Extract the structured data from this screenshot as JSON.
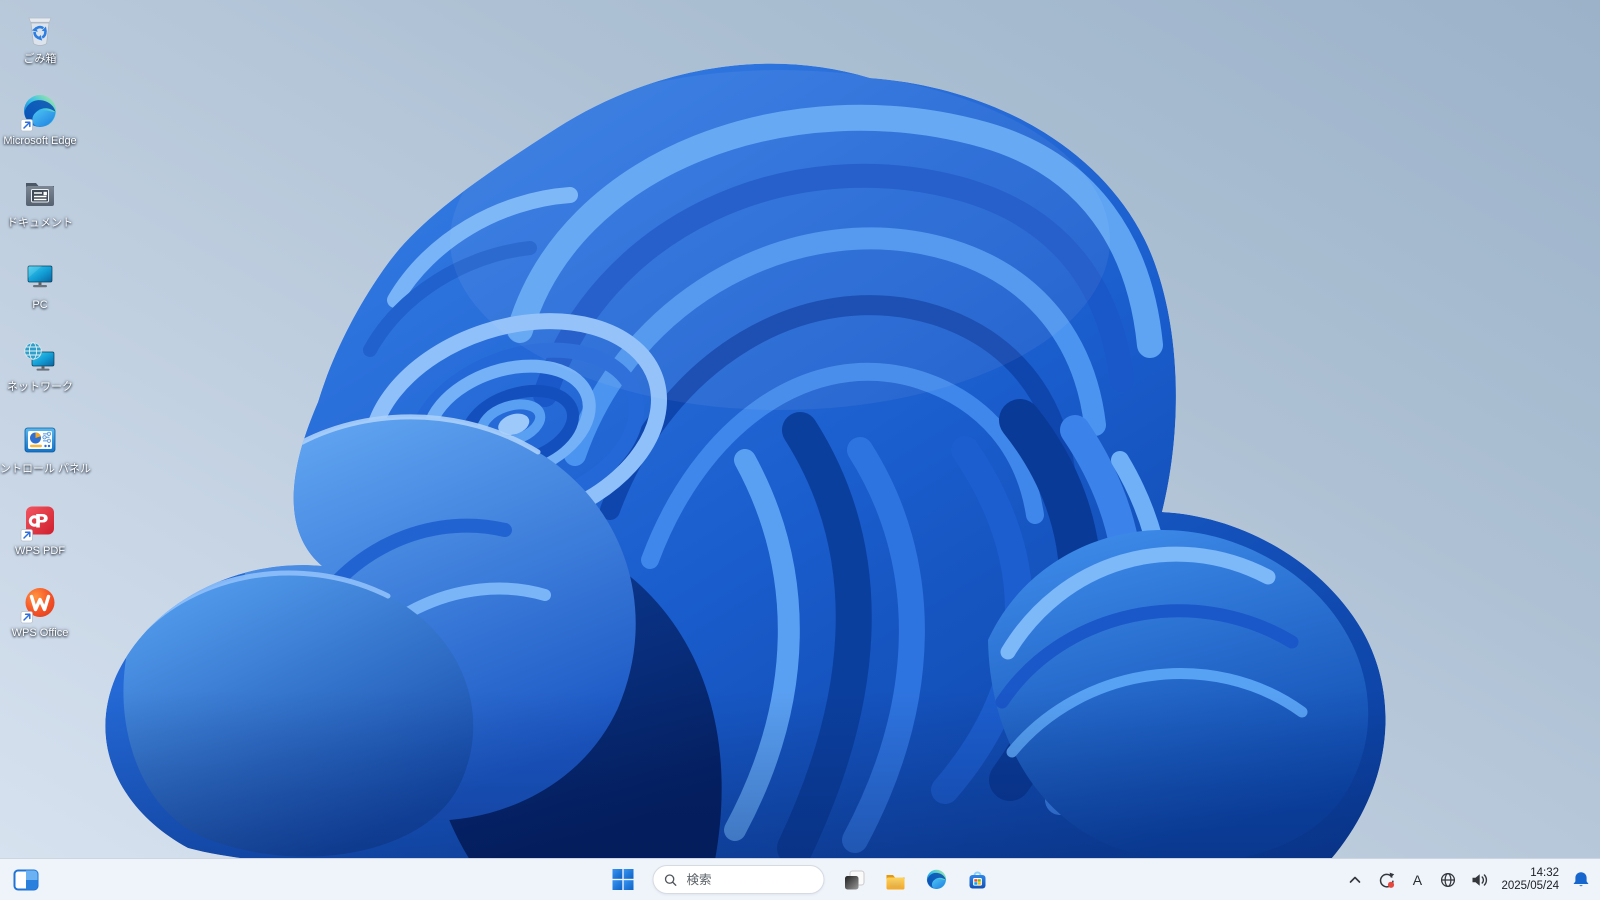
{
  "wallpaper": {
    "name": "windows-11-bloom",
    "background_top_right": "#9bb2c9",
    "background_bottom_left": "#d8e3f0",
    "bloom_primary": "#1f66d9"
  },
  "desktop": {
    "icons": [
      {
        "label": "ごみ箱",
        "icon": "recycle-bin-icon",
        "shortcut": false
      },
      {
        "label": "Microsoft Edge",
        "icon": "edge-icon",
        "shortcut": true
      },
      {
        "label": "ドキュメント",
        "icon": "documents-folder-icon",
        "shortcut": false
      },
      {
        "label": "PC",
        "icon": "pc-monitor-icon",
        "shortcut": false
      },
      {
        "label": "ネットワーク",
        "icon": "network-globe-monitor-icon",
        "shortcut": false
      },
      {
        "label": "コントロール パネル",
        "icon": "control-panel-icon",
        "shortcut": false
      },
      {
        "label": "WPS PDF",
        "icon": "wps-pdf-icon",
        "shortcut": true
      },
      {
        "label": "WPS Office",
        "icon": "wps-office-icon",
        "shortcut": true
      }
    ]
  },
  "taskbar": {
    "colors": {
      "background": "#eff3fa",
      "accent": "#0d6bd0"
    },
    "corner_left": {
      "icon": "widgets-icon"
    },
    "start": {
      "icon": "windows-start-icon"
    },
    "search": {
      "placeholder": "検索",
      "icon": "search-icon"
    },
    "pinned": [
      {
        "icon": "task-view-icon"
      },
      {
        "icon": "file-explorer-icon"
      },
      {
        "icon": "edge-icon"
      },
      {
        "icon": "microsoft-store-icon"
      }
    ],
    "tray": {
      "overflow": {
        "icon": "chevron-up-icon"
      },
      "update": {
        "icon": "sync-update-icon",
        "badge_color": "#e5483e"
      },
      "ime_mode": "A",
      "network": {
        "icon": "globe-network-icon"
      },
      "volume": {
        "icon": "speaker-icon"
      },
      "clock": {
        "time": "14:32",
        "date": "2025/05/24"
      },
      "notifications": {
        "icon": "bell-icon",
        "color": "#1766cd"
      }
    }
  }
}
